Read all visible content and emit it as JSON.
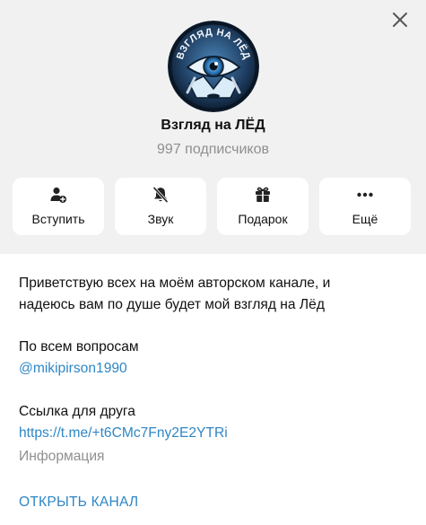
{
  "channel": {
    "title": "Взгляд на ЛЁД",
    "subscribers": "997 подписчиков",
    "logo_text": "ВЗГЛЯД НА ЛЁД"
  },
  "actions": [
    {
      "label": "Вступить",
      "icon": "add-user-icon"
    },
    {
      "label": "Звук",
      "icon": "bell-muted-icon"
    },
    {
      "label": "Подарок",
      "icon": "gift-icon"
    },
    {
      "label": "Ещё",
      "icon": "more-dots-icon"
    }
  ],
  "about": {
    "line1": "Приветствую всех на моём авторском канале, и",
    "line2": "надеюсь вам по душе будет мой взгляд на Лёд",
    "questions_label": "По всем вопросам",
    "questions_contact": "@mikipirson1990",
    "friend_label": "Ссылка для друга",
    "friend_link": "https://t.me/+t6CMc7Fny2E2YTRi",
    "info_label": "Информация"
  },
  "open_channel": "ОТКРЫТЬ КАНАЛ",
  "colors": {
    "header_bg": "#f1f1f1",
    "link": "#2f86c5",
    "muted": "#8f8f8f"
  }
}
